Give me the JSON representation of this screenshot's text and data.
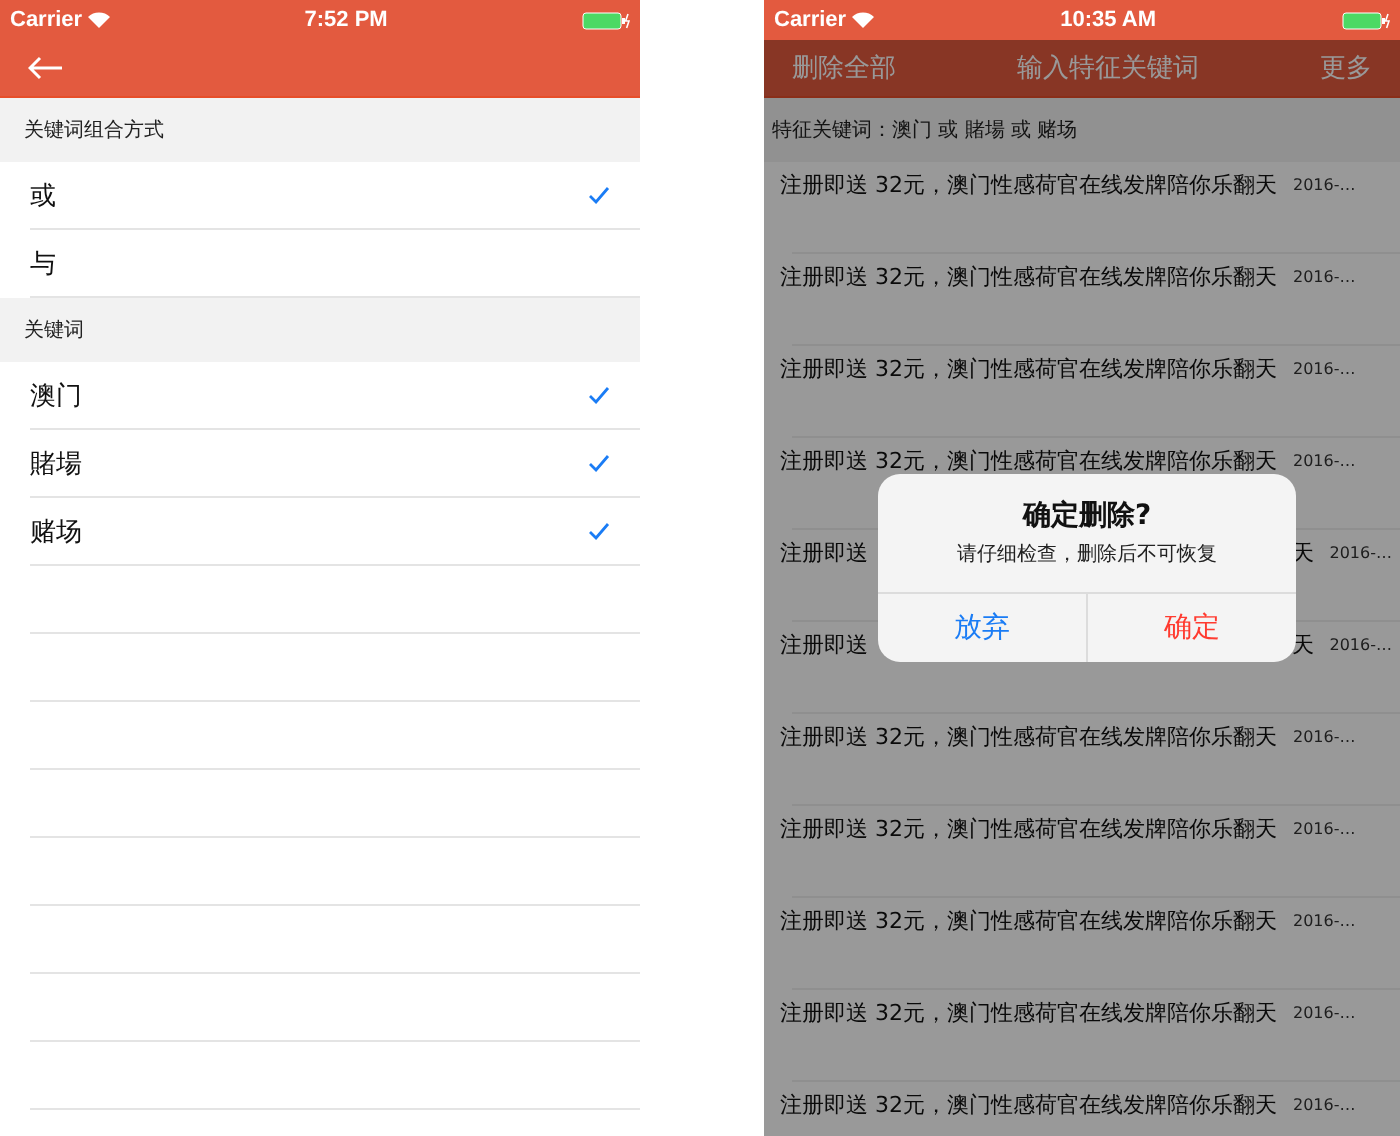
{
  "left_screen": {
    "status_bar": {
      "carrier": "Carrier",
      "time": "7:52 PM"
    },
    "sections": [
      {
        "header": "关键词组合方式",
        "items": [
          {
            "label": "或",
            "checked": true
          },
          {
            "label": "与",
            "checked": false
          }
        ]
      },
      {
        "header": "关键词",
        "items": [
          {
            "label": "澳门",
            "checked": true
          },
          {
            "label": "賭場",
            "checked": true
          },
          {
            "label": "赌场",
            "checked": true
          }
        ]
      }
    ]
  },
  "right_screen": {
    "status_bar": {
      "carrier": "Carrier",
      "time": "10:35 AM"
    },
    "nav": {
      "left": "删除全部",
      "title": "输入特征关键词",
      "right": "更多"
    },
    "filter": "特征关键词：澳门 或 賭場 或 赌场",
    "rows": [
      {
        "kind": "full",
        "title": "注册即送 32元，澳门性感荷官在线发牌陪你乐翻天",
        "date": "2016-…"
      },
      {
        "kind": "full",
        "title": "注册即送 32元，澳门性感荷官在线发牌陪你乐翻天",
        "date": "2016-…"
      },
      {
        "kind": "full",
        "title": "注册即送 32元，澳门性感荷官在线发牌陪你乐翻天",
        "date": "2016-…"
      },
      {
        "kind": "full",
        "title": "注册即送 32元，澳门性感荷官在线发牌陪你乐翻天",
        "date": "2016-…"
      },
      {
        "kind": "partial",
        "start": "注册即送",
        "end": "天",
        "date": "2016-…"
      },
      {
        "kind": "partial",
        "start": "注册即送",
        "end": "天",
        "date": "2016-…"
      },
      {
        "kind": "full",
        "title": "注册即送 32元，澳门性感荷官在线发牌陪你乐翻天",
        "date": "2016-…"
      },
      {
        "kind": "full",
        "title": "注册即送 32元，澳门性感荷官在线发牌陪你乐翻天",
        "date": "2016-…"
      },
      {
        "kind": "full",
        "title": "注册即送 32元，澳门性感荷官在线发牌陪你乐翻天",
        "date": "2016-…"
      },
      {
        "kind": "full",
        "title": "注册即送 32元，澳门性感荷官在线发牌陪你乐翻天",
        "date": "2016-…"
      },
      {
        "kind": "full",
        "title": "注册即送 32元，澳门性感荷官在线发牌陪你乐翻天",
        "date": "2016-…"
      }
    ],
    "alert": {
      "title": "确定删除?",
      "message": "请仔细检查，删除后不可恢复",
      "buttons": [
        {
          "label": "放弃",
          "kind": "cancel"
        },
        {
          "label": "确定",
          "kind": "destructive"
        }
      ]
    }
  }
}
